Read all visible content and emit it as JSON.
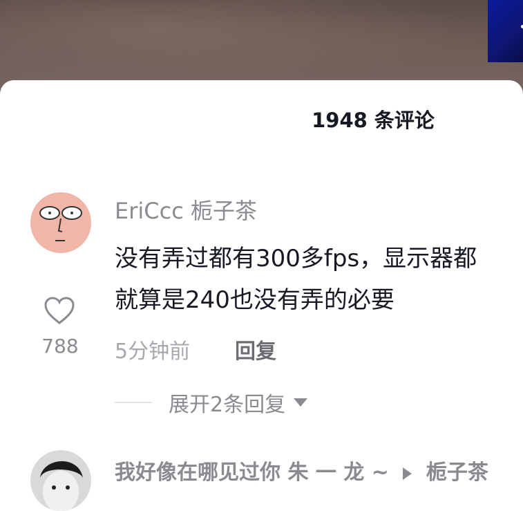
{
  "header": {
    "title": "1948 条评论"
  },
  "comments": [
    {
      "username": "EriCcc 栀子茶",
      "text_lines": [
        "没有弄过都有300多fps，显示器都",
        "就算是240也没有弄的必要"
      ],
      "time": "5分钟前",
      "reply_label": "回复",
      "likes": "788",
      "expand_label": "展开2条回复"
    },
    {
      "username_a": "我好像在哪见过你 朱 一 龙 ~",
      "username_b": "栀子茶"
    }
  ],
  "icons": {
    "like": "heart-outline-icon",
    "expand": "caret-down-icon",
    "reply_arrow": "play-triangle-icon"
  },
  "colors": {
    "username": "#8a8b91",
    "text": "#161823",
    "meta": "#a7a8ad"
  }
}
